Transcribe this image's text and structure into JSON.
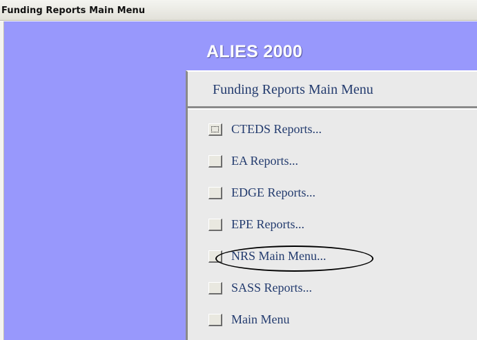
{
  "window": {
    "title": "Funding Reports Main Menu"
  },
  "app": {
    "title": "ALIES 2000"
  },
  "panel": {
    "title": "Funding Reports Main Menu"
  },
  "menu": {
    "items": [
      {
        "label": "CTEDS Reports...",
        "focused": true
      },
      {
        "label": "EA Reports..."
      },
      {
        "label": "EDGE Reports..."
      },
      {
        "label": "EPE Reports..."
      },
      {
        "label": "NRS Main Menu...",
        "highlighted": true
      },
      {
        "label": "SASS Reports..."
      },
      {
        "label": "Main Menu"
      }
    ]
  },
  "colors": {
    "background": "#9898fc",
    "panel": "#eaeaea",
    "label_text": "#233b6e",
    "app_title": "#ffffff"
  }
}
